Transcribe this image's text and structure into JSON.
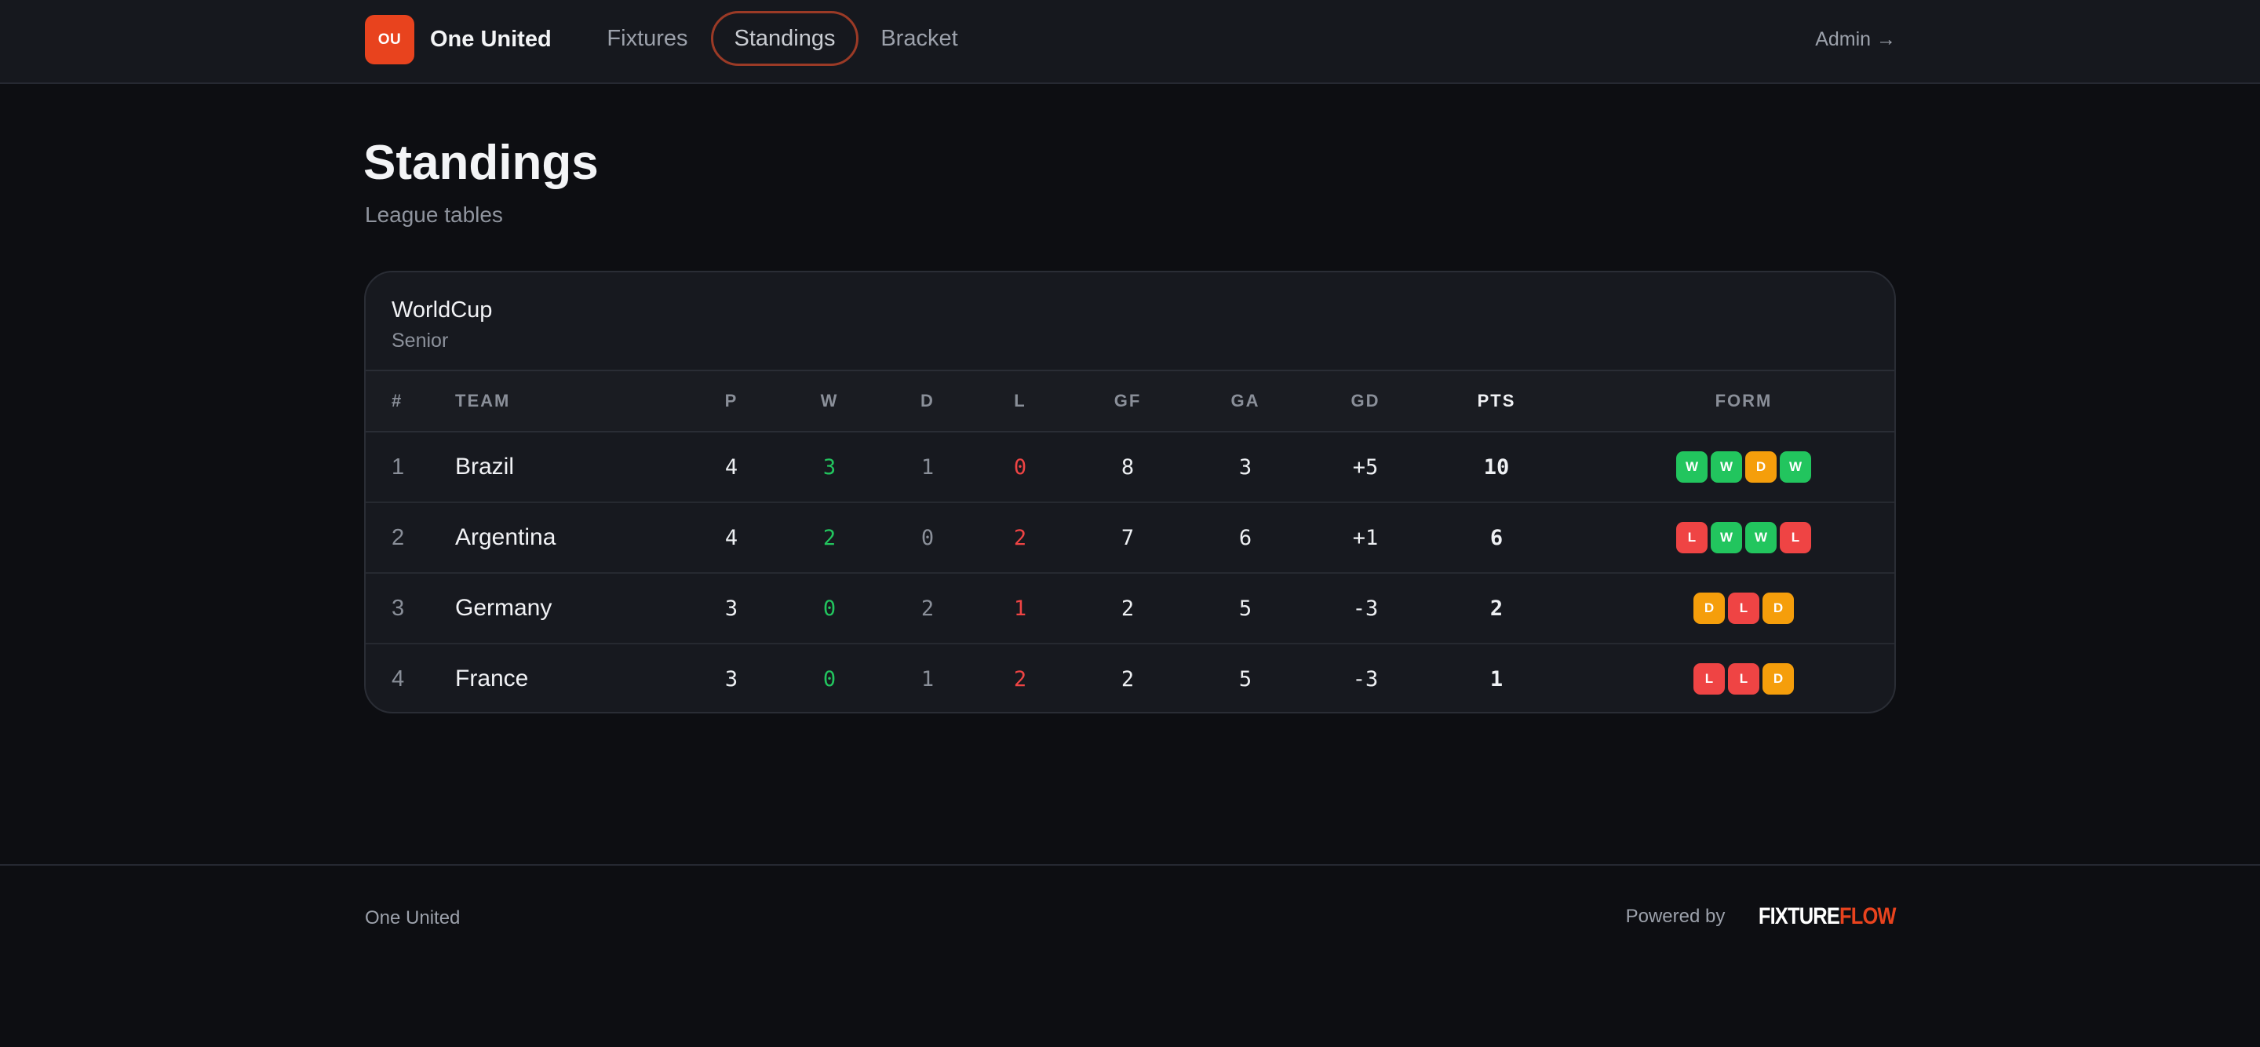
{
  "header": {
    "logo_initials": "OU",
    "brand": "One United",
    "nav": [
      {
        "label": "Fixtures",
        "active": false
      },
      {
        "label": "Standings",
        "active": true
      },
      {
        "label": "Bracket",
        "active": false
      }
    ],
    "admin_label": "Admin →"
  },
  "page": {
    "title": "Standings",
    "subtitle": "League tables"
  },
  "table": {
    "title": "WorldCup",
    "subtitle": "Senior",
    "columns": [
      "#",
      "TEAM",
      "P",
      "W",
      "D",
      "L",
      "GF",
      "GA",
      "GD",
      "PTS",
      "FORM"
    ],
    "rows": [
      {
        "rank": "1",
        "team": "Brazil",
        "p": "4",
        "w": "3",
        "d": "1",
        "l": "0",
        "gf": "8",
        "ga": "3",
        "gd": "+5",
        "pts": "10",
        "form": [
          "W",
          "W",
          "D",
          "W"
        ]
      },
      {
        "rank": "2",
        "team": "Argentina",
        "p": "4",
        "w": "2",
        "d": "0",
        "l": "2",
        "gf": "7",
        "ga": "6",
        "gd": "+1",
        "pts": "6",
        "form": [
          "L",
          "W",
          "W",
          "L"
        ]
      },
      {
        "rank": "3",
        "team": "Germany",
        "p": "3",
        "w": "0",
        "d": "2",
        "l": "1",
        "gf": "2",
        "ga": "5",
        "gd": "-3",
        "pts": "2",
        "form": [
          "D",
          "L",
          "D"
        ]
      },
      {
        "rank": "4",
        "team": "France",
        "p": "3",
        "w": "0",
        "d": "1",
        "l": "2",
        "gf": "2",
        "ga": "5",
        "gd": "-3",
        "pts": "1",
        "form": [
          "L",
          "L",
          "D"
        ]
      }
    ]
  },
  "footer": {
    "left": "One United",
    "powered_by": "Powered by",
    "logo_part1": "FIXTURE",
    "logo_part2": "FLOW"
  },
  "colors": {
    "accent": "#e8431e",
    "win": "#22c55e",
    "draw": "#f59e0b",
    "loss": "#ef4444",
    "background": "#0d0e12"
  }
}
